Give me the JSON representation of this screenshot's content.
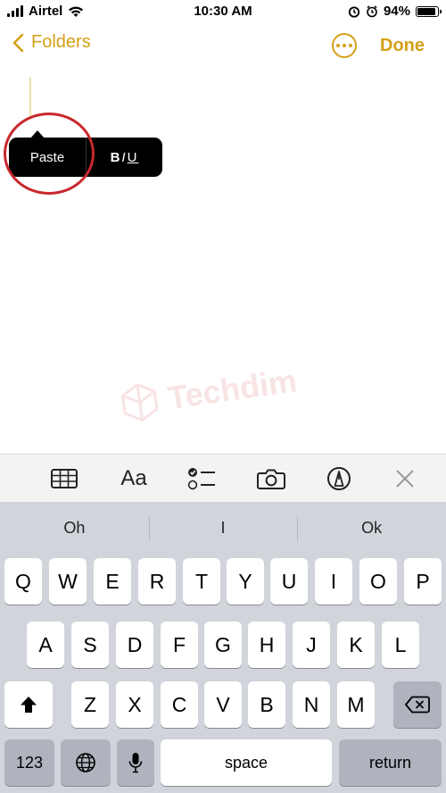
{
  "status_bar": {
    "carrier": "Airtel",
    "time": "10:30 AM",
    "battery": "94%",
    "battery_level": 0.94
  },
  "nav": {
    "back_label": "Folders",
    "done_label": "Done"
  },
  "edit_menu": {
    "paste_label": "Paste",
    "bold_label": "B",
    "italic_label": "I",
    "underline_label": "U"
  },
  "watermark": {
    "text": "Techdim"
  },
  "toolbar": {
    "icons": [
      "table-icon",
      "text-format-icon",
      "checklist-icon",
      "camera-icon",
      "markup-icon",
      "close-icon"
    ],
    "format_label": "Aa"
  },
  "keyboard": {
    "suggestions": [
      "Oh",
      "I",
      "Ok"
    ],
    "row1": [
      "Q",
      "W",
      "E",
      "R",
      "T",
      "Y",
      "U",
      "I",
      "O",
      "P"
    ],
    "row2": [
      "A",
      "S",
      "D",
      "F",
      "G",
      "H",
      "J",
      "K",
      "L"
    ],
    "row3": [
      "Z",
      "X",
      "C",
      "V",
      "B",
      "N",
      "M"
    ],
    "numbers_label": "123",
    "space_label": "space",
    "return_label": "return"
  },
  "colors": {
    "accent": "#d4a017",
    "highlight_circle": "#c8282e",
    "keyboard_bg": "#d1d4db"
  }
}
